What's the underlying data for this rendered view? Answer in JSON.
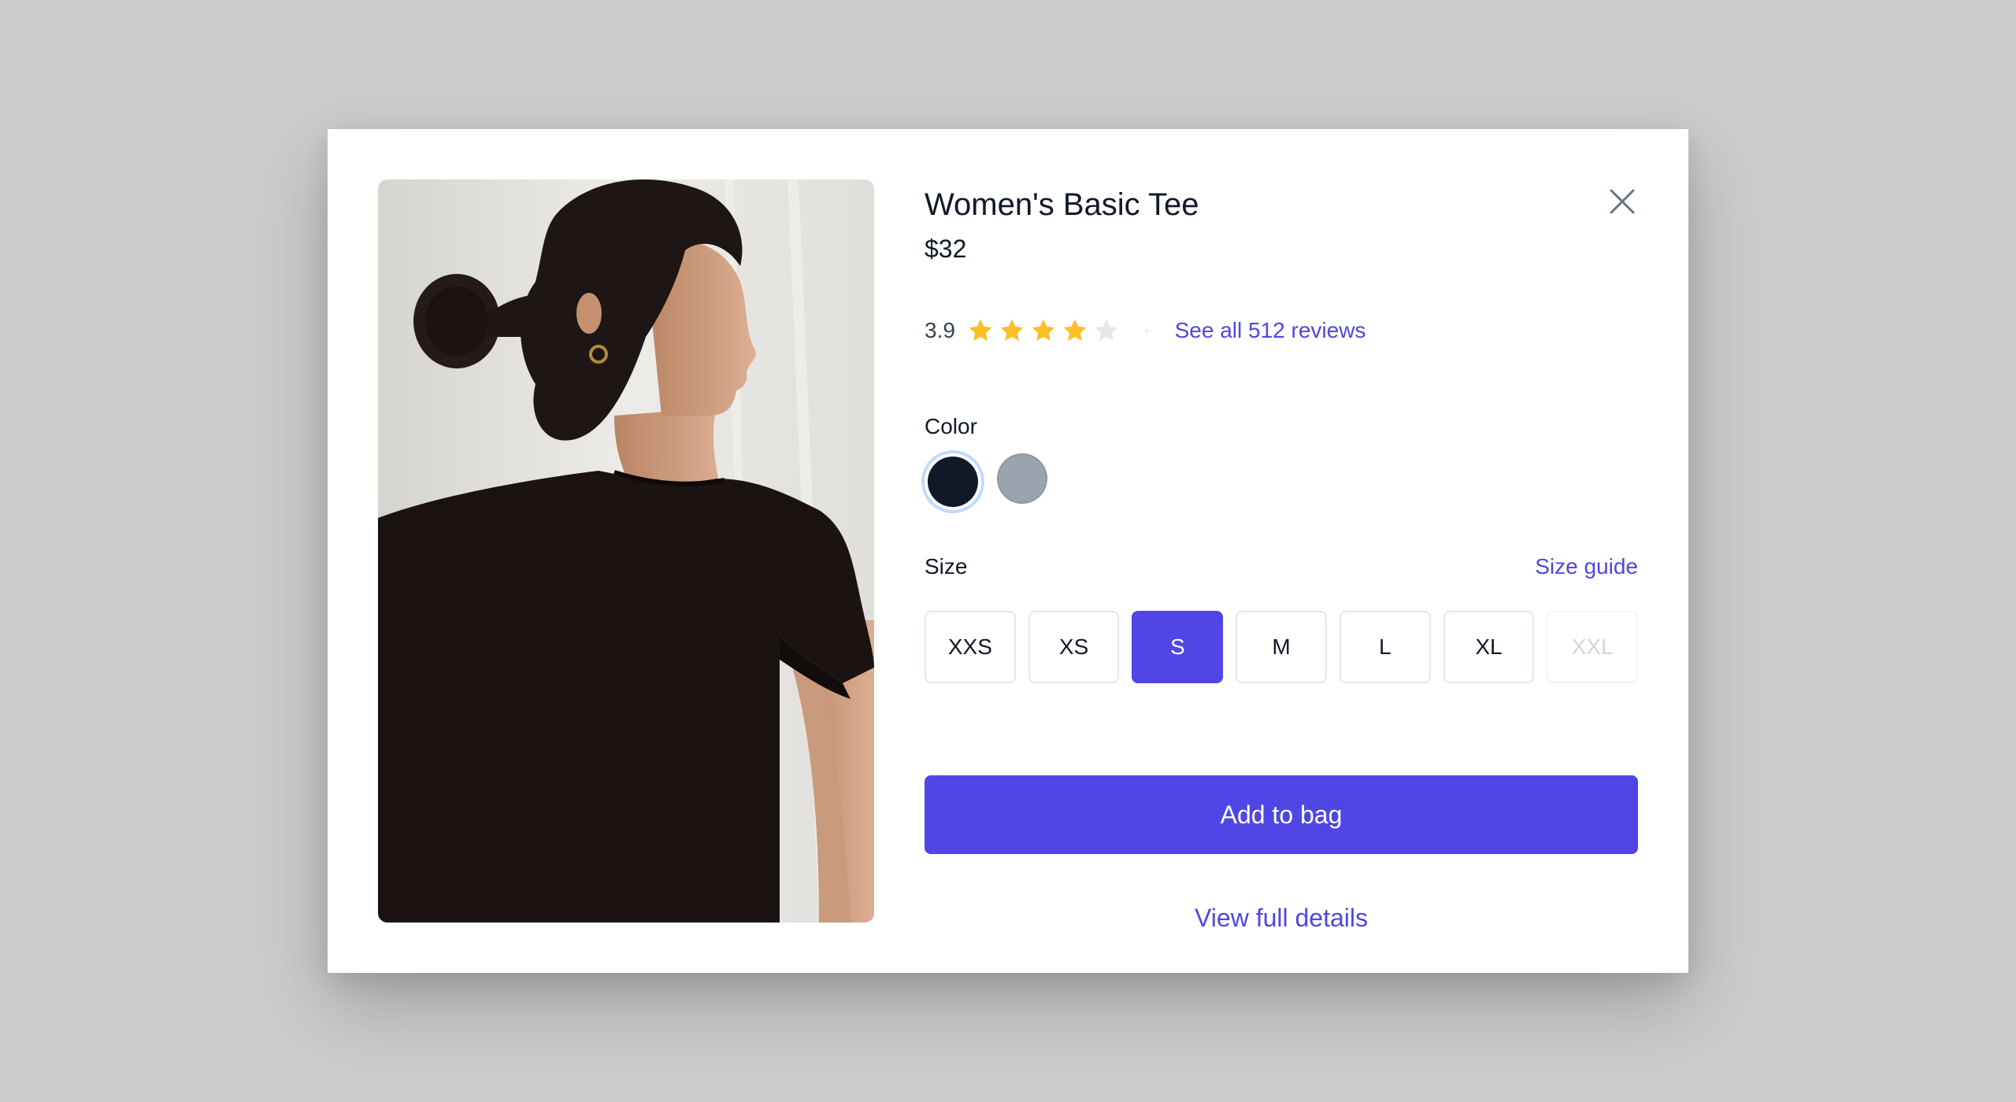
{
  "product": {
    "title": "Women's Basic Tee",
    "price": "$32",
    "image_alt": "Woman wearing black t-shirt, back view"
  },
  "rating": {
    "value_text": "3.9",
    "value": 3.9,
    "max": 5,
    "separator": "·",
    "reviews_link": "See all 512 reviews",
    "star_color": "#fbbf24",
    "star_empty_color": "#e5e7eb"
  },
  "color": {
    "label": "Color",
    "options": [
      {
        "name": "Black",
        "hex": "#111827",
        "selected": true
      },
      {
        "name": "Gray",
        "hex": "#9ca3af",
        "selected": false
      }
    ]
  },
  "size": {
    "label": "Size",
    "guide_link": "Size guide",
    "options": [
      {
        "label": "XXS",
        "state": "available"
      },
      {
        "label": "XS",
        "state": "available"
      },
      {
        "label": "S",
        "state": "selected"
      },
      {
        "label": "M",
        "state": "available"
      },
      {
        "label": "L",
        "state": "available"
      },
      {
        "label": "XL",
        "state": "available"
      },
      {
        "label": "XXL",
        "state": "disabled"
      }
    ]
  },
  "actions": {
    "add_to_bag": "Add to bag",
    "view_details": "View full details"
  },
  "colors": {
    "accent": "#4f46e5",
    "text": "#111827",
    "overlay": "#cccccc"
  }
}
